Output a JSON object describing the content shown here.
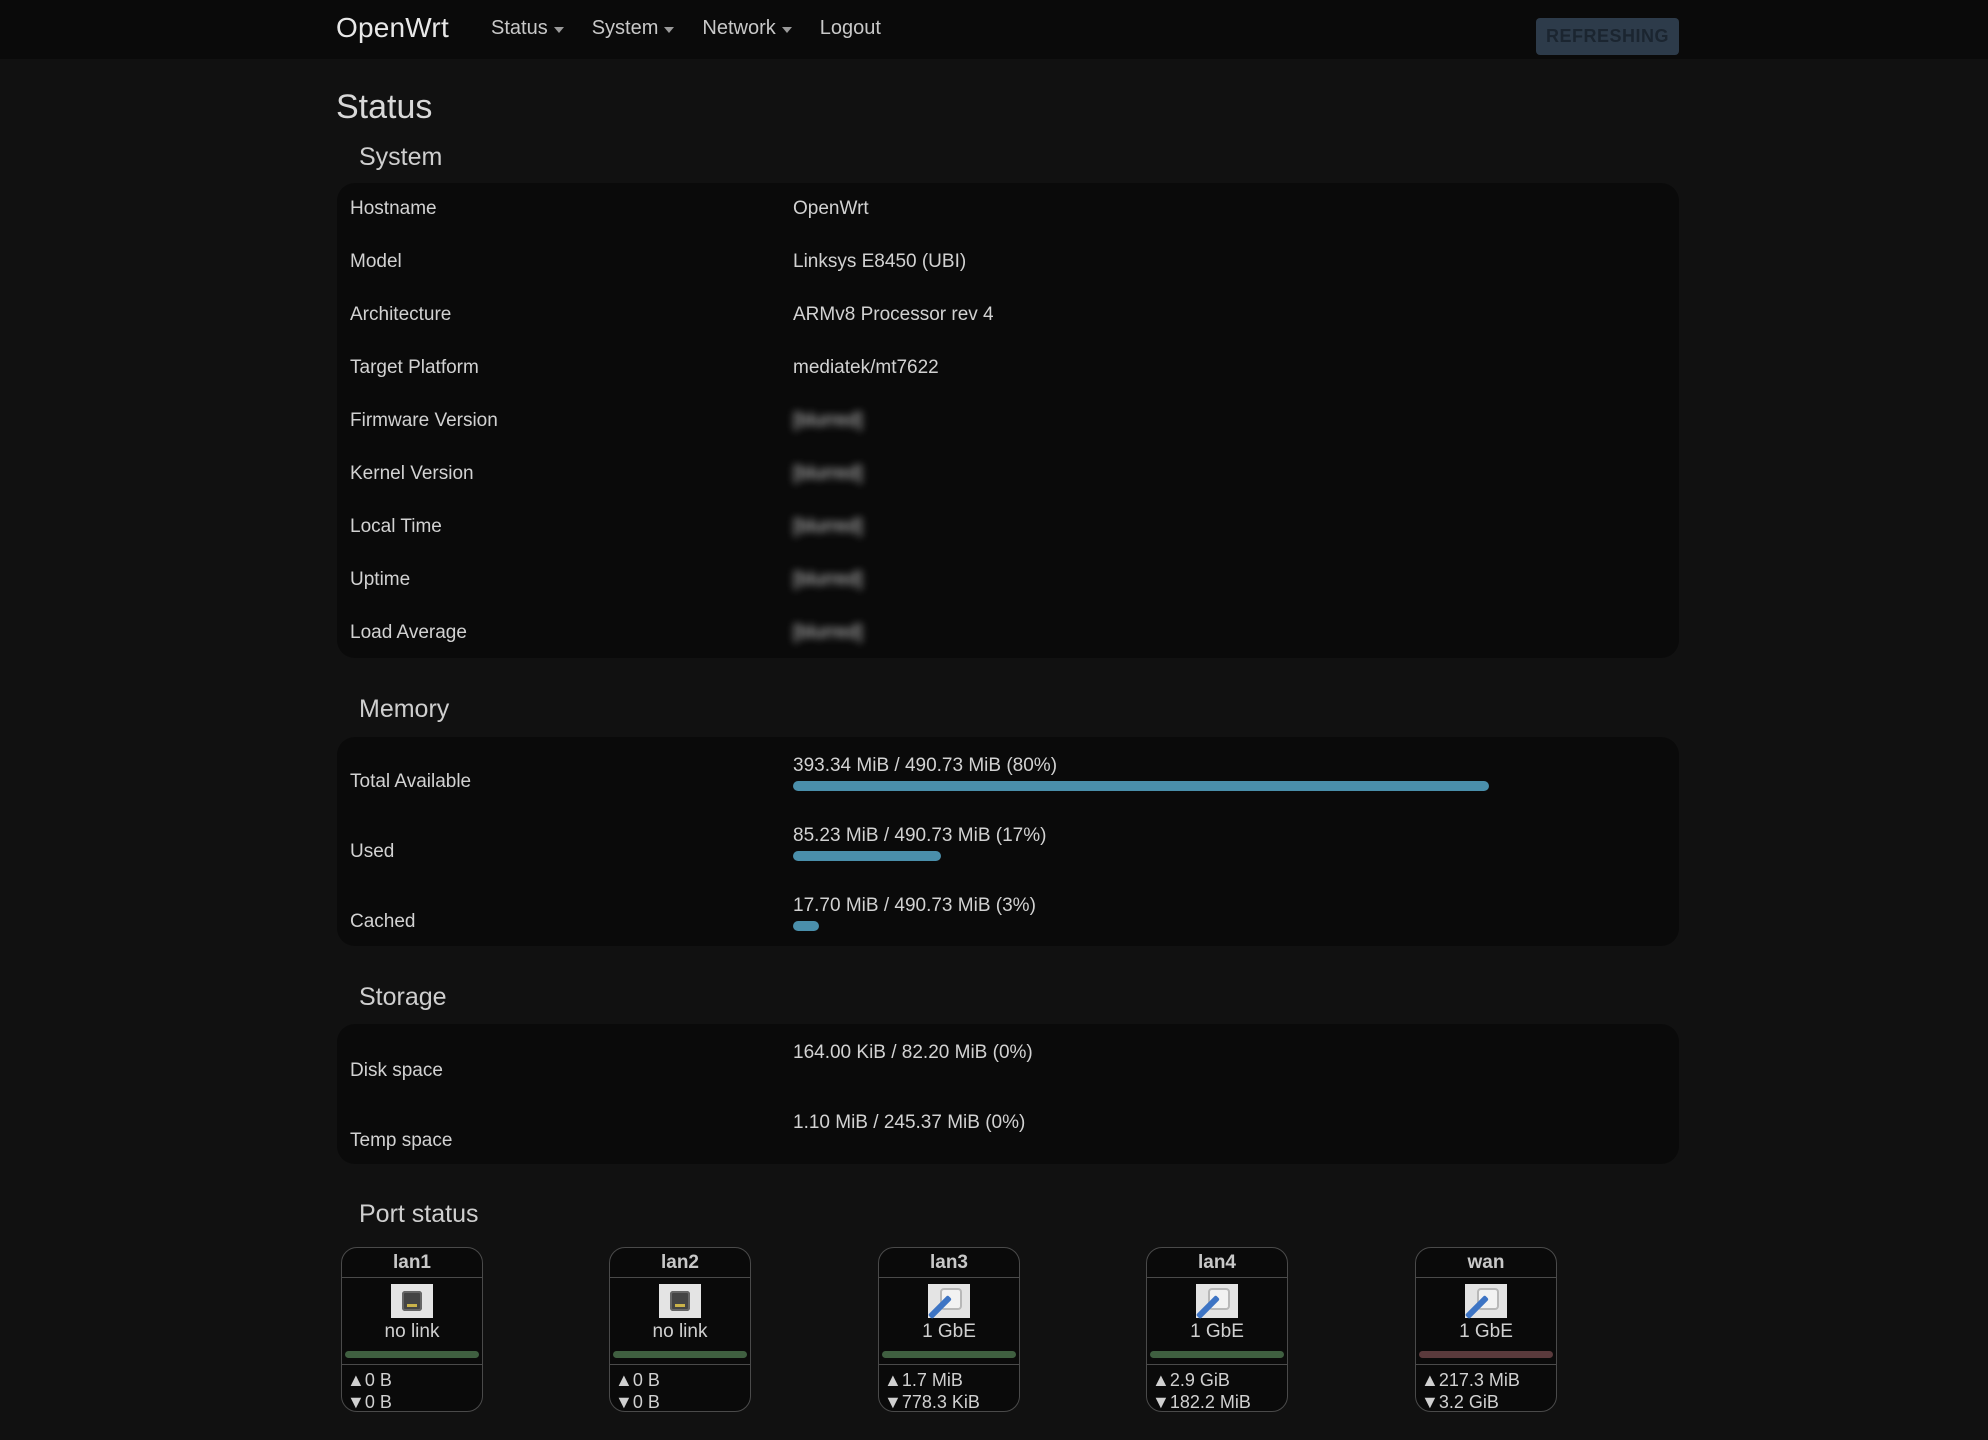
{
  "navbar": {
    "brand": "OpenWrt",
    "menu": [
      {
        "label": "Status",
        "dropdown": true
      },
      {
        "label": "System",
        "dropdown": true
      },
      {
        "label": "Network",
        "dropdown": true
      },
      {
        "label": "Logout",
        "dropdown": false
      }
    ],
    "refresh_label": "REFRESHING"
  },
  "page": {
    "title": "Status"
  },
  "system": {
    "title": "System",
    "rows": [
      {
        "label": "Hostname",
        "value": "OpenWrt",
        "blurred": false
      },
      {
        "label": "Model",
        "value": "Linksys E8450 (UBI)",
        "blurred": false
      },
      {
        "label": "Architecture",
        "value": "ARMv8 Processor rev 4",
        "blurred": false
      },
      {
        "label": "Target Platform",
        "value": "mediatek/mt7622",
        "blurred": false
      },
      {
        "label": "Firmware Version",
        "value": "[blurred]",
        "blurred": true
      },
      {
        "label": "Kernel Version",
        "value": "[blurred]",
        "blurred": true
      },
      {
        "label": "Local Time",
        "value": "[blurred]",
        "blurred": true
      },
      {
        "label": "Uptime",
        "value": "[blurred]",
        "blurred": true
      },
      {
        "label": "Load Average",
        "value": "[blurred]",
        "blurred": true
      }
    ]
  },
  "memory": {
    "title": "Memory",
    "rows": [
      {
        "label": "Total Available",
        "value": "393.34 MiB / 490.73 MiB (80%)",
        "percent": 80
      },
      {
        "label": "Used",
        "value": "85.23 MiB / 490.73 MiB (17%)",
        "percent": 17
      },
      {
        "label": "Cached",
        "value": "17.70 MiB / 490.73 MiB (3%)",
        "percent": 3
      }
    ],
    "bar_color": "#4a8fab"
  },
  "storage": {
    "title": "Storage",
    "rows": [
      {
        "label": "Disk space",
        "value": "164.00 KiB / 82.20 MiB (0%)",
        "percent": 0
      },
      {
        "label": "Temp space",
        "value": "1.10 MiB / 245.37 MiB (0%)",
        "percent": 0
      }
    ]
  },
  "ports": {
    "title": "Port status",
    "items": [
      {
        "name": "lan1",
        "link": false,
        "speed": "no link",
        "tx": "0 B",
        "rx": "0 B",
        "led_color": "#3f5f40"
      },
      {
        "name": "lan2",
        "link": false,
        "speed": "no link",
        "tx": "0 B",
        "rx": "0 B",
        "led_color": "#3f5f40"
      },
      {
        "name": "lan3",
        "link": true,
        "speed": "1 GbE",
        "tx": "1.7 MiB",
        "rx": "778.3 KiB",
        "led_color": "#3f5f40"
      },
      {
        "name": "lan4",
        "link": true,
        "speed": "1 GbE",
        "tx": "2.9 GiB",
        "rx": "182.2 MiB",
        "led_color": "#3f5f40"
      },
      {
        "name": "wan",
        "link": true,
        "speed": "1 GbE",
        "tx": "217.3 MiB",
        "rx": "3.2 GiB",
        "led_color": "#5a3a3c"
      }
    ],
    "tx_symbol": "▲",
    "rx_symbol": "▼"
  }
}
